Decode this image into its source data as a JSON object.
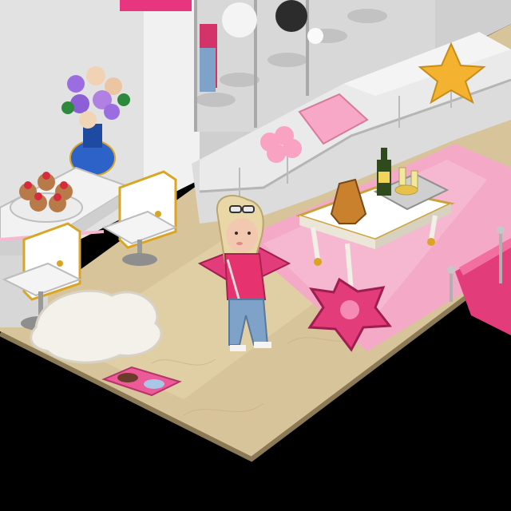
{
  "scene": {
    "type": "isometric-room",
    "style": "pixel-art"
  },
  "palette": {
    "void": "#000000",
    "floor": "#d8c49a",
    "floor_light": "#e9dbb6",
    "floor_edge": "#9c8a62",
    "wall": "#e6e6e6",
    "wall_shade": "#bdbdbd",
    "pink_rug": "#f4a9c6",
    "pink_hot": "#e8357f",
    "sofa": "#e4e4e4",
    "gold": "#d9a523",
    "avatar_hair": "#e9d7a8",
    "avatar_top": "#e6336f",
    "avatar_jeans": "#7fa2c8"
  },
  "furniture": [
    {
      "id": "flower-vase",
      "icon": "vase-roses-icon"
    },
    {
      "id": "cupcake-platter",
      "icon": "cupcake-icon"
    },
    {
      "id": "white-chair-1",
      "icon": "chair-icon"
    },
    {
      "id": "white-chair-2",
      "icon": "chair-icon"
    },
    {
      "id": "fluffy-rug",
      "icon": "rug-icon"
    },
    {
      "id": "pet-bowl",
      "icon": "bowl-icon"
    },
    {
      "id": "sectional-sofa",
      "icon": "sofa-icon"
    },
    {
      "id": "star-pillow",
      "icon": "star-icon"
    },
    {
      "id": "coffee-table",
      "icon": "table-icon"
    },
    {
      "id": "champagne-bottle",
      "icon": "bottle-icon"
    },
    {
      "id": "star-floor-cushion",
      "icon": "cushion-icon"
    },
    {
      "id": "square-floor-cushion",
      "icon": "cushion-icon"
    },
    {
      "id": "pink-bed",
      "icon": "bed-icon"
    },
    {
      "id": "display-cabinet",
      "icon": "cabinet-icon"
    }
  ],
  "avatar": {
    "icon": "avatar-icon",
    "accessory": "sunglasses-icon"
  }
}
